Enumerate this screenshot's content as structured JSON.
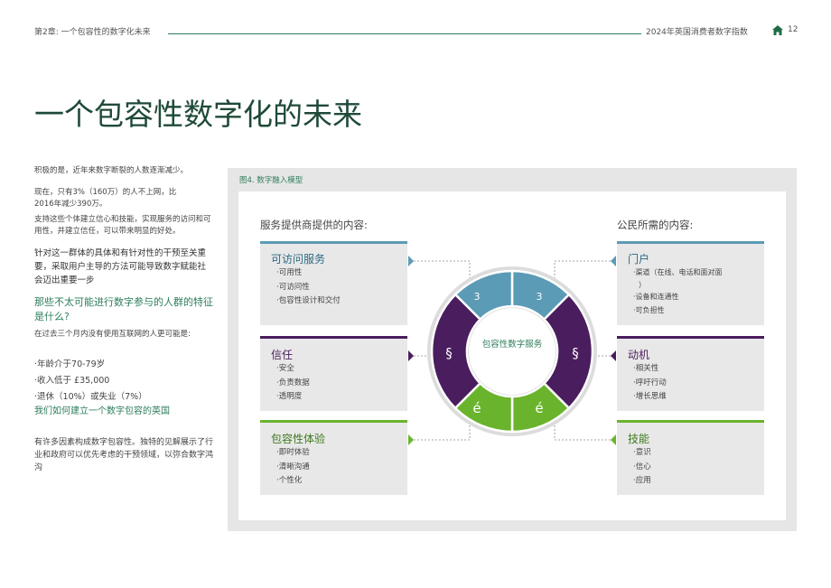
{
  "header": {
    "chapter": "第2章: 一个包容性的数字化未来",
    "report": "2024年英国消费者数字指数",
    "page": "12"
  },
  "title": "一个包容性数字化的未来",
  "sidebar": {
    "p1": "积极的是，近年来数字断裂的人数逐渐减少。",
    "p2": "现在，只有3%（160万）的人不上网，比2016年减少390万。",
    "p3": "支持这些个体建立信心和技能，实现服务的访问和可用性，并建立信任，可以带来明显的好处。",
    "p4": "针对这一群体的具体和有针对性的干预至关重要，采取用户主导的方法可能导致数字赋能社会迈出重要一步",
    "q1": "那些不太可能进行数字参与的人群的特征是什么?",
    "p5": "在过去三个月内没有使用互联网的人更可能是:",
    "bullets": [
      "·年龄介于70-79岁",
      "·收入低于 £35,000",
      "·退休（10%）或失业（7%）"
    ],
    "q2": "我们如何建立一个数字包容的英国",
    "p6": "有许多因素构成数字包容性。独特的见解展示了行业和政府可以优先考虑的干预领域，以弥合数字鸿沟"
  },
  "figure": {
    "label": "图4. 数字融入模型",
    "left_heading": "服务提供商提供的内容:",
    "right_heading": "公民所需的内容:",
    "center_label": "包容性数字服务",
    "segment_glyphs": {
      "top": "3",
      "middle": "§",
      "bottom": "é"
    },
    "left_boxes": [
      {
        "title": "可访问服务",
        "items": [
          "·可用性",
          "·可访问性",
          "·包容性设计和交付"
        ]
      },
      {
        "title": "信任",
        "items": [
          "·安全",
          "·负责数据",
          "·透明度"
        ]
      },
      {
        "title": "包容性体验",
        "items": [
          "·即时体验",
          "·清晰沟通",
          "·个性化"
        ]
      }
    ],
    "right_boxes": [
      {
        "title": "门户",
        "items": [
          "·渠道（在线、电话和面对面",
          "）",
          "·设备和连通性",
          "·可负担性"
        ]
      },
      {
        "title": "动机",
        "items": [
          "·相关性",
          "·呼吁行动",
          "·增长思维"
        ]
      },
      {
        "title": "技能",
        "items": [
          "·意识",
          "·信心",
          "·应用"
        ]
      }
    ],
    "colors": {
      "blue": "#5b9bb5",
      "purple": "#4a1d5e",
      "green": "#6ab42d",
      "title_green": "#1f4a38",
      "accent_green": "#2e7d5b"
    }
  }
}
